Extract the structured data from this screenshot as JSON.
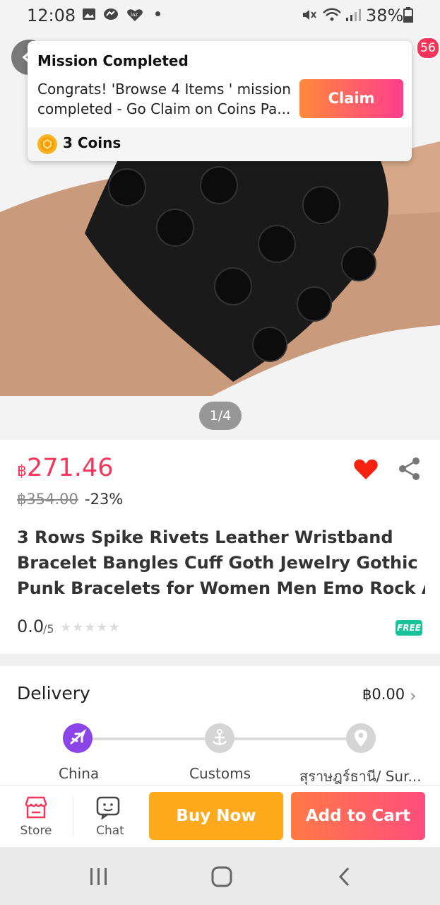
{
  "status_bar": {
    "time": "12:08",
    "battery": "38%"
  },
  "header": {
    "cart_badge": "56"
  },
  "image": {
    "counter": "1/4"
  },
  "mission_popup": {
    "title": "Mission Completed",
    "body_line1": "Congrats! 'Browse 4 Items ' mission",
    "body_line2": "completed - Go Claim on Coins Pa...",
    "claim_label": "Claim",
    "coins": "3 Coins"
  },
  "product": {
    "currency": "฿",
    "price": "271.46",
    "original_price": "฿354.00",
    "discount": "-23%",
    "title_line1": "3 Rows Spike Rivets Leather Wristband",
    "title_line2": "Bracelet Bangles Cuff Goth Jewelry Gothic",
    "title_line3": "Punk Bracelets for Women Men Emo Rock A...",
    "rating": "0.0",
    "rating_max": "/5",
    "stars": "★★★★★",
    "free_badge": "FREE"
  },
  "delivery": {
    "title": "Delivery",
    "price": "฿0.00",
    "chevron": "›",
    "steps": [
      "China",
      "Customs",
      "สุราษฎร์ธานี/ Sur..."
    ]
  },
  "bottom_bar": {
    "store_label": "Store",
    "chat_label": "Chat",
    "buy_now_label": "Buy Now",
    "add_to_cart_label": "Add to Cart"
  },
  "colors": {
    "price": "#f5365a",
    "buy_now": "#ffaa1d",
    "claim_start": "#ff8a3a",
    "claim_end": "#ff3d8d",
    "track_active": "#8a44e8"
  },
  "icons": [
    "gallery-icon",
    "messenger-icon",
    "lazada-icon",
    "mute-icon",
    "wifi-icon",
    "signal-icon",
    "battery-icon",
    "back-icon",
    "coin-icon",
    "heart-icon",
    "share-icon",
    "airplane-icon",
    "anchor-icon",
    "location-pin-icon",
    "store-icon",
    "chat-icon",
    "recents-icon",
    "home-icon",
    "back-nav-icon"
  ]
}
